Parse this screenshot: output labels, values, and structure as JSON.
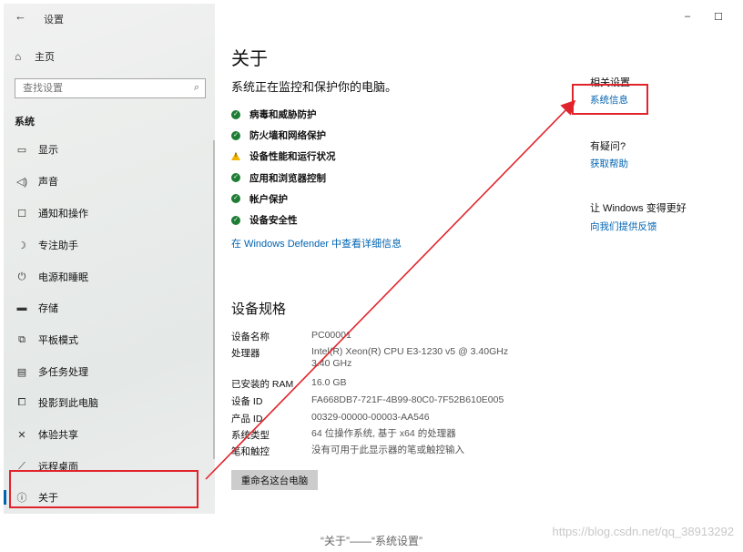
{
  "window": {
    "title": "设置",
    "back_icon": "←",
    "minimize_icon": "–",
    "maximize_icon": "☐"
  },
  "sidebar": {
    "home_label": "主页",
    "search_placeholder": "查找设置",
    "section_label": "系统",
    "items": [
      {
        "label": "显示",
        "icon": "display-icon"
      },
      {
        "label": "声音",
        "icon": "sound-icon"
      },
      {
        "label": "通知和操作",
        "icon": "notification-icon"
      },
      {
        "label": "专注助手",
        "icon": "moon-icon"
      },
      {
        "label": "电源和睡眠",
        "icon": "power-icon"
      },
      {
        "label": "存储",
        "icon": "storage-icon"
      },
      {
        "label": "平板模式",
        "icon": "tablet-icon"
      },
      {
        "label": "多任务处理",
        "icon": "multitask-icon"
      },
      {
        "label": "投影到此电脑",
        "icon": "project-icon"
      },
      {
        "label": "体验共享",
        "icon": "share-icon"
      },
      {
        "label": "远程桌面",
        "icon": "remote-icon"
      },
      {
        "label": "关于",
        "icon": "info-icon",
        "active": true
      }
    ]
  },
  "main": {
    "title": "关于",
    "subtitle": "系统正在监控和保护你的电脑。",
    "protections": [
      {
        "label": "病毒和威胁防护",
        "status": "ok"
      },
      {
        "label": "防火墙和网络保护",
        "status": "ok"
      },
      {
        "label": "设备性能和运行状况",
        "status": "warning"
      },
      {
        "label": "应用和浏览器控制",
        "status": "ok"
      },
      {
        "label": "帐户保护",
        "status": "ok"
      },
      {
        "label": "设备安全性",
        "status": "ok"
      }
    ],
    "defender_link": "在 Windows Defender 中查看详细信息",
    "spec_title": "设备规格",
    "specs": [
      {
        "key": "设备名称",
        "value": "PC00001"
      },
      {
        "key": "处理器",
        "value": "Intel(R) Xeon(R) CPU E3-1230 v5 @ 3.40GHz 3.40 GHz"
      },
      {
        "key": "已安装的 RAM",
        "value": "16.0 GB"
      },
      {
        "key": "设备 ID",
        "value": "FA668DB7-721F-4B99-80C0-7F52B610E005"
      },
      {
        "key": "产品 ID",
        "value": "00329-00000-00003-AA546"
      },
      {
        "key": "系统类型",
        "value": "64 位操作系统, 基于 x64 的处理器"
      },
      {
        "key": "笔和触控",
        "value": "没有可用于此显示器的笔或触控输入"
      }
    ],
    "rename_button": "重命名这台电脑"
  },
  "related": {
    "title": "相关设置",
    "system_info_link": "系统信息",
    "question_title": "有疑问?",
    "help_link": "获取帮助",
    "improve_title": "让 Windows 变得更好",
    "feedback_link": "向我们提供反馈"
  },
  "caption": "“关于”——“系统设置”",
  "watermark": "https://blog.csdn.net/qq_38913292",
  "colors": {
    "accent": "#0063b1",
    "ok": "#1e7d34",
    "warning": "#f0b400",
    "annotation": "#e1242c"
  }
}
